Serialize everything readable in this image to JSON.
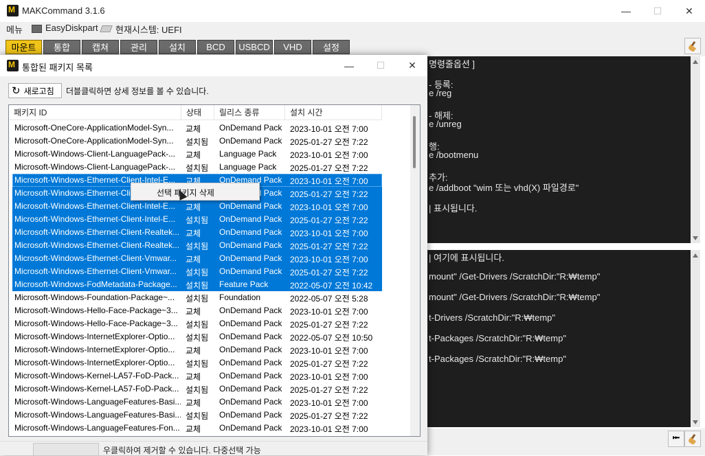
{
  "main_window": {
    "title": "MAKCommand 3.1.6",
    "controls": {
      "minimize": "—",
      "maximize": "☐",
      "close": "✕"
    }
  },
  "menubar": {
    "menu": "메뉴",
    "easydiskpart": "EasyDiskpart",
    "system_status": "현재시스템: UEFI"
  },
  "tabs": [
    {
      "label": "마운트",
      "active": true
    },
    {
      "label": "통합",
      "active": false
    },
    {
      "label": "캡쳐",
      "active": false
    },
    {
      "label": "관리",
      "active": false
    },
    {
      "label": "설치",
      "active": false
    },
    {
      "label": "BCD",
      "active": false
    },
    {
      "label": "USBCD",
      "active": false
    },
    {
      "label": "VHD",
      "active": false
    },
    {
      "label": "설정",
      "active": false
    }
  ],
  "console_top": {
    "lines": [
      "명령줄옵션 ]",
      "",
      "- 등록:",
      "e /reg",
      "",
      "- 해제:",
      "e /unreg",
      "",
      "행:",
      "e /bootmenu",
      "",
      "추가:",
      "e /addboot \"wim 또는 vhd(X) 파일경로\"",
      "",
      "| 표시됩니다."
    ]
  },
  "console_bottom": {
    "lines": [
      "| 여기에 표시됩니다.",
      "",
      "mount\" /Get-Drivers /ScratchDir:\"R:₩temp\"",
      "",
      "mount\" /Get-Drivers /ScratchDir:\"R:₩temp\"",
      "",
      "t-Drivers /ScratchDir:\"R:₩temp\"",
      "",
      "t-Packages /ScratchDir:\"R:₩temp\"",
      "",
      "t-Packages /ScratchDir:\"R:₩temp\""
    ]
  },
  "dialog": {
    "title": "통합된 패키지 목록",
    "controls": {
      "minimize": "—",
      "maximize": "☐",
      "close": "✕"
    },
    "refresh_label": "새로고침",
    "hint": "더블클릭하면 상세 정보를 볼 수 있습니다.",
    "columns": [
      "패키지 ID",
      "상태",
      "릴리스 종류",
      "설치 시간"
    ],
    "rows": [
      {
        "id": "Microsoft-OneCore-ApplicationModel-Syn...",
        "state": "교체",
        "type": "OnDemand Pack",
        "time": "2023-10-01 오전 7:00",
        "selected": false
      },
      {
        "id": "Microsoft-OneCore-ApplicationModel-Syn...",
        "state": "설치됨",
        "type": "OnDemand Pack",
        "time": "2025-01-27 오전 7:22",
        "selected": false
      },
      {
        "id": "Microsoft-Windows-Client-LanguagePack-...",
        "state": "교체",
        "type": "Language Pack",
        "time": "2023-10-01 오전 7:00",
        "selected": false
      },
      {
        "id": "Microsoft-Windows-Client-LanguagePack-...",
        "state": "설치됨",
        "type": "Language Pack",
        "time": "2025-01-27 오전 7:22",
        "selected": false
      },
      {
        "id": "Microsoft-Windows-Ethernet-Client-Intel-E...",
        "state": "교체",
        "type": "OnDemand Pack",
        "time": "2023-10-01 오전 7:00",
        "selected": true
      },
      {
        "id": "Microsoft-Windows-Ethernet-Client-Intel-E...",
        "state": "설치됨",
        "type": "OnDemand Pack",
        "time": "2025-01-27 오전 7:22",
        "selected": true
      },
      {
        "id": "Microsoft-Windows-Ethernet-Client-Intel-E...",
        "state": "교체",
        "type": "OnDemand Pack",
        "time": "2023-10-01 오전 7:00",
        "selected": true
      },
      {
        "id": "Microsoft-Windows-Ethernet-Client-Intel-E...",
        "state": "설치됨",
        "type": "OnDemand Pack",
        "time": "2025-01-27 오전 7:22",
        "selected": true
      },
      {
        "id": "Microsoft-Windows-Ethernet-Client-Realtek...",
        "state": "교체",
        "type": "OnDemand Pack",
        "time": "2023-10-01 오전 7:00",
        "selected": true
      },
      {
        "id": "Microsoft-Windows-Ethernet-Client-Realtek...",
        "state": "설치됨",
        "type": "OnDemand Pack",
        "time": "2025-01-27 오전 7:22",
        "selected": true
      },
      {
        "id": "Microsoft-Windows-Ethernet-Client-Vmwar...",
        "state": "교체",
        "type": "OnDemand Pack",
        "time": "2023-10-01 오전 7:00",
        "selected": true
      },
      {
        "id": "Microsoft-Windows-Ethernet-Client-Vmwar...",
        "state": "설치됨",
        "type": "OnDemand Pack",
        "time": "2025-01-27 오전 7:22",
        "selected": true
      },
      {
        "id": "Microsoft-Windows-FodMetadata-Package...",
        "state": "설치됨",
        "type": "Feature Pack",
        "time": "2022-05-07 오전 10:42",
        "selected": true
      },
      {
        "id": "Microsoft-Windows-Foundation-Package~...",
        "state": "설치됨",
        "type": "Foundation",
        "time": "2022-05-07 오전 5:28",
        "selected": false
      },
      {
        "id": "Microsoft-Windows-Hello-Face-Package~3...",
        "state": "교체",
        "type": "OnDemand Pack",
        "time": "2023-10-01 오전 7:00",
        "selected": false
      },
      {
        "id": "Microsoft-Windows-Hello-Face-Package~3...",
        "state": "설치됨",
        "type": "OnDemand Pack",
        "time": "2025-01-27 오전 7:22",
        "selected": false
      },
      {
        "id": "Microsoft-Windows-InternetExplorer-Optio...",
        "state": "설치됨",
        "type": "OnDemand Pack",
        "time": "2022-05-07 오전 10:50",
        "selected": false
      },
      {
        "id": "Microsoft-Windows-InternetExplorer-Optio...",
        "state": "교체",
        "type": "OnDemand Pack",
        "time": "2023-10-01 오전 7:00",
        "selected": false
      },
      {
        "id": "Microsoft-Windows-InternetExplorer-Optio...",
        "state": "설치됨",
        "type": "OnDemand Pack",
        "time": "2025-01-27 오전 7:22",
        "selected": false
      },
      {
        "id": "Microsoft-Windows-Kernel-LA57-FoD-Pack...",
        "state": "교체",
        "type": "OnDemand Pack",
        "time": "2023-10-01 오전 7:00",
        "selected": false
      },
      {
        "id": "Microsoft-Windows-Kernel-LA57-FoD-Pack...",
        "state": "설치됨",
        "type": "OnDemand Pack",
        "time": "2025-01-27 오전 7:22",
        "selected": false
      },
      {
        "id": "Microsoft-Windows-LanguageFeatures-Basi...",
        "state": "교체",
        "type": "OnDemand Pack",
        "time": "2023-10-01 오전 7:00",
        "selected": false
      },
      {
        "id": "Microsoft-Windows-LanguageFeatures-Basi...",
        "state": "설치됨",
        "type": "OnDemand Pack",
        "time": "2025-01-27 오전 7:22",
        "selected": false
      },
      {
        "id": "Microsoft-Windows-LanguageFeatures-Fon...",
        "state": "교체",
        "type": "OnDemand Pack",
        "time": "2023-10-01 오전 7:00",
        "selected": false
      }
    ],
    "context_menu": {
      "item": "선택 패키지 삭제"
    },
    "status_text": "우클릭하여 제거할 수 있습니다. 다중선택 가능"
  },
  "colors": {
    "tab_active": "#f0c419",
    "tab_inactive": "#6b6b6b",
    "selection": "#0078d7",
    "console_bg": "#1e1e1e"
  },
  "icons": {
    "app": "makcommand-logo-icon",
    "cleanup": "broom-icon",
    "back": "back-arrow-icon",
    "refresh": "refresh-icon"
  }
}
